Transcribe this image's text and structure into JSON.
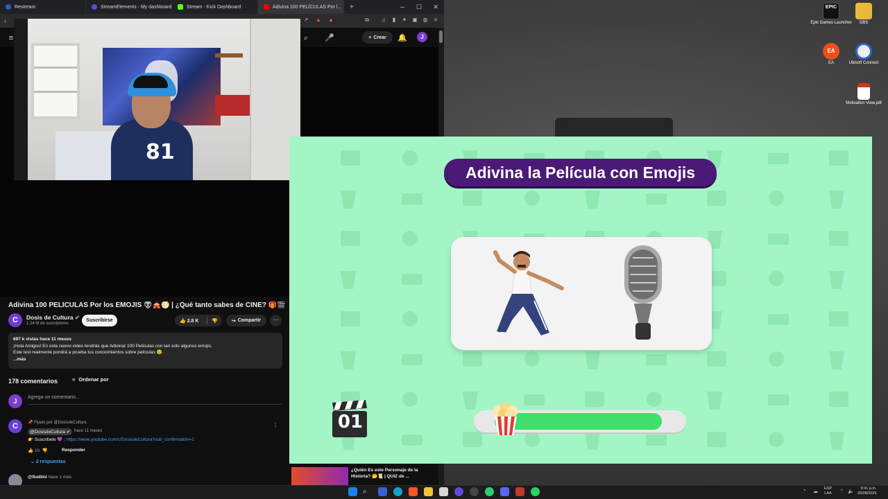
{
  "browser": {
    "tabs": [
      {
        "label": "Restream",
        "color": "#2a5bd7"
      },
      {
        "label": "StreamElements - My dashboard",
        "color": "#5b4cd6"
      },
      {
        "label": "Stream - Kick Dashboard",
        "color": "#53fc18"
      },
      {
        "label": "Adivina 100 PELÍCULAS Por l...",
        "color": "#ff0000"
      }
    ],
    "new_tab": "+",
    "header": {
      "create_label": "Crear",
      "avatar_letter": "J"
    }
  },
  "video": {
    "title": "Adivina 100 PELÍCULAS Por los EMOJIS 👽🎪🌕 | ¿Qué tanto sabes de CINE? 🎁🎬",
    "channel": "Dosis de Cultura",
    "channel_logo": "C",
    "subscribers": "1.24 M de suscriptores",
    "subscribe_label": "Suscribirse",
    "likes": "2.8 K",
    "share_label": "Compartir",
    "more_label": "⋯",
    "description": {
      "meta": "697 k vistas  hace 11 meses",
      "line1": "¡Hola Amigos! En este nuevo video tendrás que Adivinar 100 Películas con tan solo algunos emojis.",
      "line2": "Este test realmente pondrá a prueba tus conocimientos sobre películas 😉.",
      "more": "...más"
    }
  },
  "comments": {
    "count_label": "178 comentarios",
    "sort_label": "Ordenar por",
    "add_placeholder": "Agrega un comentario...",
    "my_avatar": "J",
    "pinned": {
      "pinned_by": "Fijado por @DosisdeCultura",
      "author": "@DosisdeCultura ✔",
      "time": "hace 11 meses",
      "text_prefix": "👉 Suscribete 💜 : ",
      "link": "https://www.youtube.com/c/DosisdeCultura?sub_confirmation=1",
      "likes": "10",
      "reply_label": "Responder",
      "replies_label": "2 respuestas"
    },
    "second": {
      "author": "@fiudiini",
      "time": "hace 1 mes"
    }
  },
  "recommendation": {
    "title": "¿Quién Es este Personaje de la Historia? 🤔📜 | QUIZ de ..."
  },
  "game": {
    "title": "Adivina la Película con Emojis",
    "emojis": [
      "🕺",
      "🎙️"
    ],
    "question_number": "01",
    "progress": 0.9,
    "bg_color": "#a3f5c5",
    "accent": "#4b1a77",
    "progress_color": "#3de06a"
  },
  "desktop_icons": [
    {
      "label": "Epic Games Launcher",
      "icon": "epic-games-icon"
    },
    {
      "label": "OBS",
      "icon": "folder-icon"
    },
    {
      "label": "EA",
      "icon": "ea-icon"
    },
    {
      "label": "Ubisoft Connect",
      "icon": "ubisoft-icon"
    },
    {
      "label": "Motivation View.pdf",
      "icon": "pdf-icon"
    }
  ],
  "taskbar": {
    "lang1": "ESP",
    "lang2": "LAA",
    "time": "8:41 p.m.",
    "date": "26/08/2025"
  }
}
